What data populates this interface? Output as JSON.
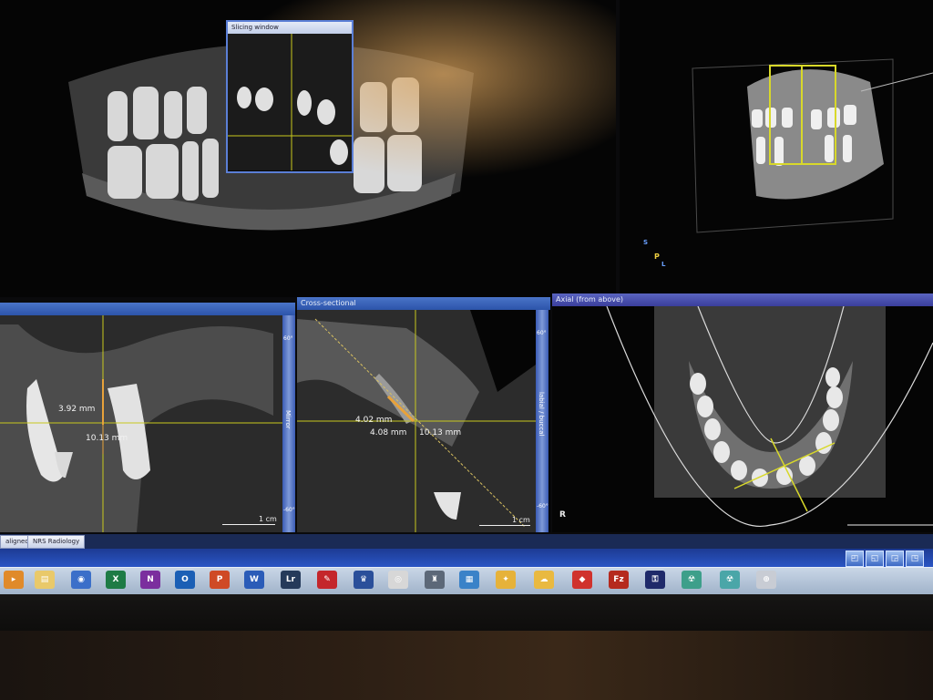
{
  "panels": {
    "slicing_window": {
      "title": "Slicing window"
    },
    "cross_sectional": {
      "title": "Cross-sectional",
      "vertical_label": "labial / buccal",
      "tick_top": "60°",
      "tick_bottom": "-60°"
    },
    "left_section": {
      "tick_top": "60°",
      "tick_bottom": "-60°",
      "vertical_label": "Mirror"
    },
    "axial": {
      "title": "Axial (from above)",
      "orientation": "R"
    }
  },
  "orientation_cube": {
    "s": "S",
    "p": "P",
    "l": "L"
  },
  "measurements": {
    "left_a": "3.92 mm",
    "left_b": "10.13 mm",
    "cs_a": "4.02 mm",
    "cs_b": "4.08 mm",
    "cs_c": "10.13 mm"
  },
  "scale": {
    "left": "1 cm",
    "cross": "1 cm"
  },
  "status_tabs": [
    "aligned",
    "NRS Radiology"
  ],
  "toolbar_buttons": [
    "◰",
    "◱",
    "◲",
    "◳",
    "◴"
  ],
  "taskbar_icons": [
    {
      "name": "start-icon",
      "glyph": "▸",
      "color": "#e08a2a"
    },
    {
      "name": "folder-icon",
      "glyph": "▤",
      "color": "#e9c96a"
    },
    {
      "name": "browser-icon",
      "glyph": "◉",
      "color": "#3b6fc9"
    },
    {
      "name": "excel-icon",
      "glyph": "X",
      "color": "#1e7b45"
    },
    {
      "name": "onenote-icon",
      "glyph": "N",
      "color": "#7b2f9e"
    },
    {
      "name": "outlook-icon",
      "glyph": "O",
      "color": "#1b5fb5"
    },
    {
      "name": "powerpoint-icon",
      "glyph": "P",
      "color": "#cf4a25"
    },
    {
      "name": "word-icon",
      "glyph": "W",
      "color": "#2b5cb8"
    },
    {
      "name": "lightroom-icon",
      "glyph": "Lr",
      "color": "#253a5a"
    },
    {
      "name": "pdf-icon",
      "glyph": "✎",
      "color": "#c4262b"
    },
    {
      "name": "tooth-app-icon",
      "glyph": "♛",
      "color": "#2a4f9a"
    },
    {
      "name": "viewer-icon",
      "glyph": "◎",
      "color": "#d7d7d7"
    },
    {
      "name": "tooth-grey-icon",
      "glyph": "♜",
      "color": "#5c6878"
    },
    {
      "name": "scan-icon",
      "glyph": "▦",
      "color": "#3a82c8"
    },
    {
      "name": "pinwheel-icon",
      "glyph": "✦",
      "color": "#e6b23a"
    },
    {
      "name": "cloud-icon",
      "glyph": "☁",
      "color": "#e9b940"
    },
    {
      "name": "paint-icon",
      "glyph": "◆",
      "color": "#d0322d"
    },
    {
      "name": "filezilla-icon",
      "glyph": "Fz",
      "color": "#b52a1e"
    },
    {
      "name": "key-icon",
      "glyph": "⚿",
      "color": "#1f2a6a"
    },
    {
      "name": "radiation-icon",
      "glyph": "☢",
      "color": "#3d9f8a"
    },
    {
      "name": "radiation-blue-icon",
      "glyph": "☢",
      "color": "#4aa6a8"
    },
    {
      "name": "globe-icon",
      "glyph": "⊕",
      "color": "#c8ccd4"
    }
  ],
  "colors": {
    "crosshair": "#c8c81e",
    "window_blue": "#2c54aa",
    "measure": "#e8a23a"
  }
}
